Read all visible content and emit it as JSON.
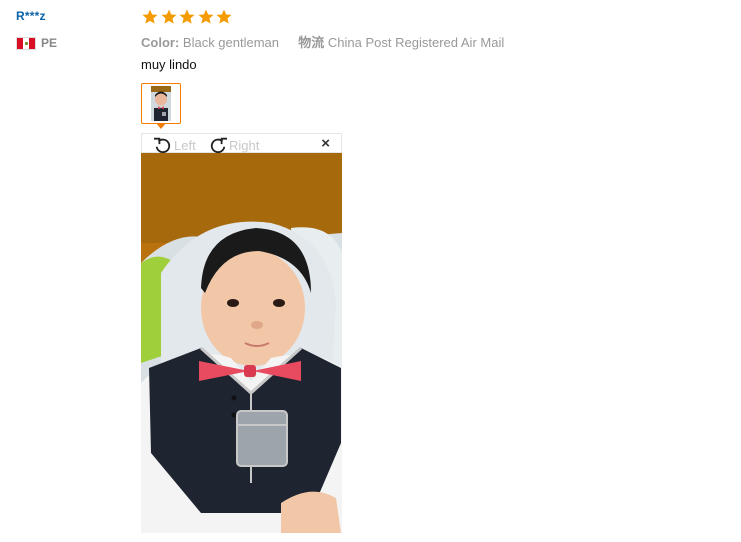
{
  "reviewer": {
    "name": "R***z",
    "country_code": "PE",
    "flag_icon": "peru-flag-icon"
  },
  "review": {
    "rating": 5,
    "rating_max": 5,
    "star_color": "#f49b00",
    "attributes": [
      {
        "key": "Color:",
        "value": "Black gentleman"
      },
      {
        "key": "物流",
        "value": "China Post Registered Air Mail"
      }
    ],
    "text": "muy lindo"
  },
  "image_viewer": {
    "rotate_left_label": "Left",
    "rotate_right_label": "Right",
    "rotate_left_icon": "rotate-left-icon",
    "rotate_right_icon": "rotate-right-icon",
    "close_icon": "close-icon",
    "close_glyph": "×",
    "accent_color": "#f47c00"
  },
  "photo": {
    "description_icon": "baby-photo"
  }
}
